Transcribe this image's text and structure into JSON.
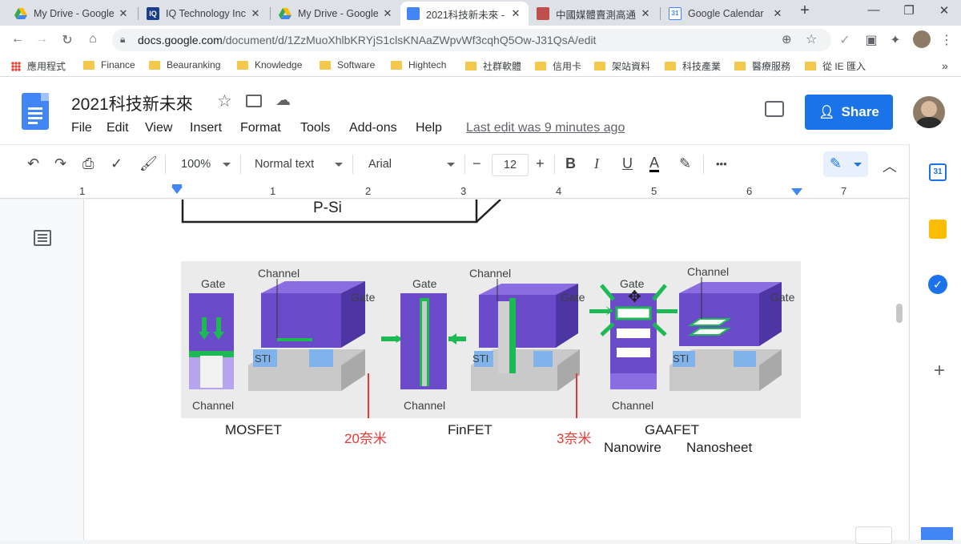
{
  "browser": {
    "tabs": [
      {
        "title": "My Drive - Google",
        "icon": "google-drive-icon"
      },
      {
        "title": "IQ Technology Inc",
        "icon": "iq-icon"
      },
      {
        "title": "My Drive - Google",
        "icon": "google-drive-icon"
      },
      {
        "title": "2021科技新未來 -",
        "icon": "google-docs-icon"
      },
      {
        "title": "中國媒體賣測高通",
        "icon": "image-icon"
      },
      {
        "title": "Google Calendar",
        "icon": "google-calendar-icon"
      }
    ],
    "new_tab": "+",
    "url_host": "docs.google.com",
    "url_path": "/document/d/1ZzMuoXhlbKRYjS1clsKNAaZWpvWf3cqhQ5Ow-J31QsA/edit",
    "bookmarks": [
      "應用程式",
      "Finance",
      "Beauranking",
      "Knowledge",
      "Software",
      "Hightech",
      "社群軟體",
      "信用卡",
      "架站資料",
      "科技產業",
      "醫療服務",
      "從 IE 匯入"
    ]
  },
  "doc": {
    "title": "2021科技新未來",
    "menus": [
      "File",
      "Edit",
      "View",
      "Insert",
      "Format",
      "Tools",
      "Add-ons",
      "Help"
    ],
    "last_edit": "Last edit was 9 minutes ago",
    "share_label": "Share"
  },
  "toolbar": {
    "zoom": "100%",
    "style": "Normal text",
    "font": "Arial",
    "font_size": "12",
    "minus": "−",
    "plus": "+",
    "bold": "B",
    "italic": "I",
    "underline": "U",
    "text_color": "A",
    "more": "•••"
  },
  "ruler": {
    "numbers": [
      "1",
      "1",
      "2",
      "3",
      "4",
      "5",
      "6",
      "7"
    ]
  },
  "content": {
    "top_box_label": "P-Si",
    "figure": {
      "labels": {
        "gate1": "Gate",
        "channel1": "Channel",
        "gate1b": "Gate",
        "sti1": "STI",
        "channel1b": "Channel",
        "gate2": "Gate",
        "channel2": "Channel",
        "gate2b": "Gate",
        "sti2": "STI",
        "channel2b": "Channel",
        "gate3": "Gate",
        "channel3": "Channel",
        "gate3b": "Gate",
        "sti3": "STI",
        "channel3b": "Channel"
      }
    },
    "captions": {
      "mosfet": "MOSFET",
      "node20": "20奈米",
      "finfet": "FinFET",
      "node3": "3奈米",
      "gaafet": "GAAFET",
      "nanowire": "Nanowire",
      "nanosheet": "Nanosheet"
    }
  },
  "colors": {
    "gate_purple": "#6b4bc9",
    "gate_dark": "#4d35a3",
    "sti_blue": "#7fb3ea",
    "channel_green": "#1db954",
    "share_blue": "#1a73e8",
    "annotation_red": "#e53935"
  }
}
